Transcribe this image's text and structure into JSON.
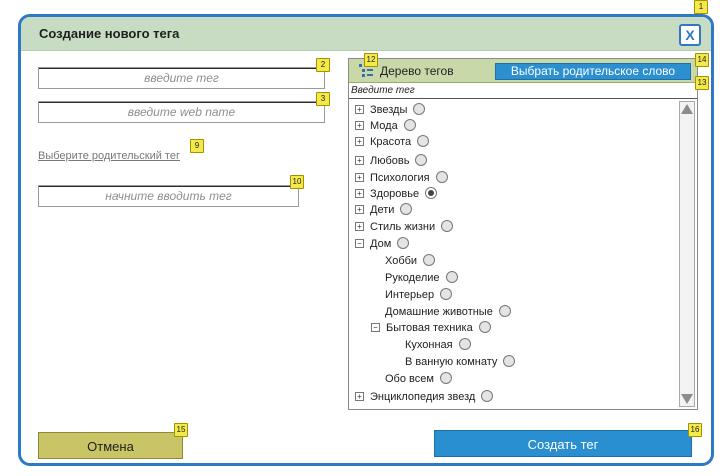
{
  "dialog": {
    "title": "Создание нового тега",
    "close_label": "X"
  },
  "fields": {
    "tag_placeholder": "введите тег",
    "webname_placeholder": "введите web name",
    "parent_link": "Выберите родительский тег",
    "start_typing_placeholder": "начните вводить тег"
  },
  "tree": {
    "header_label": "Дерево тегов",
    "parent_button": "Выбрать родительское слово",
    "search_label": "Введите тег",
    "nodes": [
      {
        "label": "Звезды"
      },
      {
        "label": "Мода"
      },
      {
        "label": "Красота"
      },
      {
        "label": "Любовь"
      },
      {
        "label": "Психология"
      },
      {
        "label": "Здоровье",
        "selected": true
      },
      {
        "label": "Дети"
      },
      {
        "label": "Стиль жизни"
      },
      {
        "label": "Дом",
        "expanded": true
      },
      {
        "label": "Хобби"
      },
      {
        "label": "Рукоделие"
      },
      {
        "label": "Интерьер"
      },
      {
        "label": "Домашние животные"
      },
      {
        "label": "Бытовая техника",
        "expanded": true
      },
      {
        "label": "Кухонная"
      },
      {
        "label": "В ванную комнату"
      },
      {
        "label": "Обо всем"
      },
      {
        "label": "Энциклопедия звезд"
      }
    ]
  },
  "buttons": {
    "cancel": "Отмена",
    "create": "Создать тег"
  },
  "badges": {
    "close": "1",
    "tag": "2",
    "webname": "3",
    "parent_link": "9",
    "start_typing": "10",
    "tree_header": "12",
    "search": "13",
    "parent_button": "14",
    "cancel": "15",
    "create": "16"
  }
}
